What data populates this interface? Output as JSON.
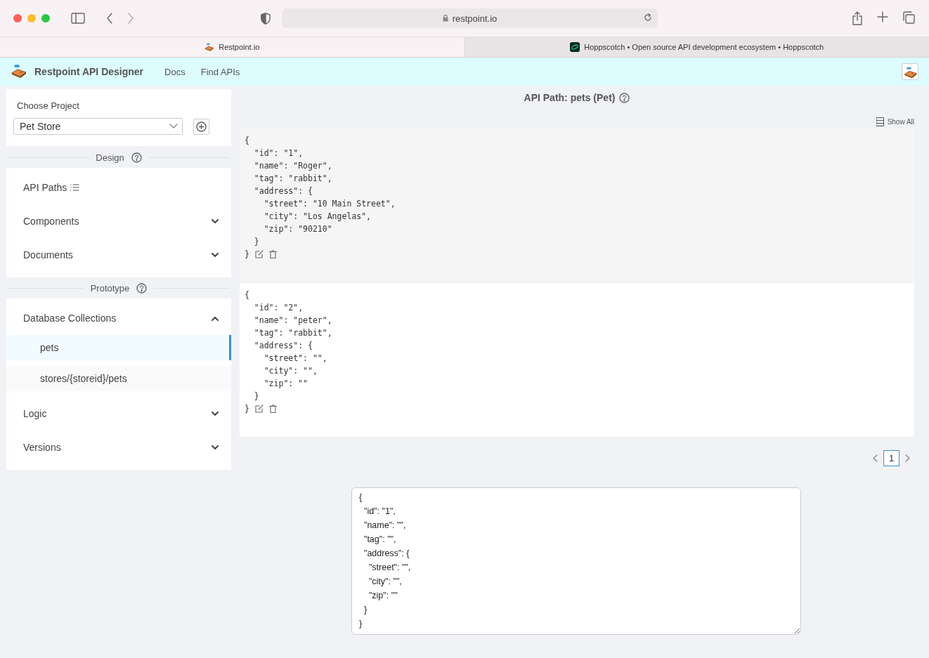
{
  "browser": {
    "address": "restpoint.io",
    "tabs": [
      {
        "label": "Restpoint.io",
        "selected": true,
        "kind": "restpoint"
      },
      {
        "label": "Hoppscotch • Open source API development ecosystem • Hoppscotch",
        "selected": false,
        "kind": "hoppscotch"
      }
    ]
  },
  "header": {
    "title": "Restpoint API Designer",
    "nav": [
      "Docs",
      "Find APIs"
    ]
  },
  "sidebar": {
    "project_label": "Choose Project",
    "project": "Pet Store",
    "sections": [
      {
        "title": "Design",
        "items": [
          {
            "label": "API Paths",
            "kind": "list"
          },
          {
            "label": "Components",
            "kind": "collapsible",
            "expanded": false
          },
          {
            "label": "Documents",
            "kind": "collapsible",
            "expanded": false
          }
        ]
      },
      {
        "title": "Prototype",
        "items": [
          {
            "label": "Database Collections",
            "kind": "collapsible",
            "expanded": true,
            "children": [
              {
                "label": "pets",
                "selected": true
              },
              {
                "label": "stores/{storeid}/pets",
                "selected": false
              }
            ]
          },
          {
            "label": "Logic",
            "kind": "collapsible",
            "expanded": false
          },
          {
            "label": "Versions",
            "kind": "collapsible",
            "expanded": false
          }
        ]
      }
    ]
  },
  "main": {
    "title": "API Path: pets (Pet)",
    "show_all": "Show All",
    "records": [
      {
        "lines": [
          "{",
          "  \"id\": \"1\",",
          "  \"name\": \"Roger\",",
          "  \"tag\": \"rabbit\",",
          "  \"address\": {",
          "    \"street\": \"10 Main Street\",",
          "    \"city\": \"Los Angelas\",",
          "    \"zip\": \"90210\"",
          "  }",
          "}"
        ]
      },
      {
        "lines": [
          "{",
          "  \"id\": \"2\",",
          "  \"name\": \"peter\",",
          "  \"tag\": \"rabbit\",",
          "  \"address\": {",
          "    \"street\": \"\",",
          "    \"city\": \"\",",
          "    \"zip\": \"\"",
          "  }",
          "}"
        ]
      }
    ],
    "pages": [
      {
        "label": "1",
        "selected": true
      }
    ],
    "editor": "{\n  \"id\": \"1\",\n  \"name\": \"\",\n  \"tag\": \"\",\n  \"address\": {\n    \"street\": \"\",\n    \"city\": \"\",\n    \"zip\": \"\"\n  }\n}"
  }
}
